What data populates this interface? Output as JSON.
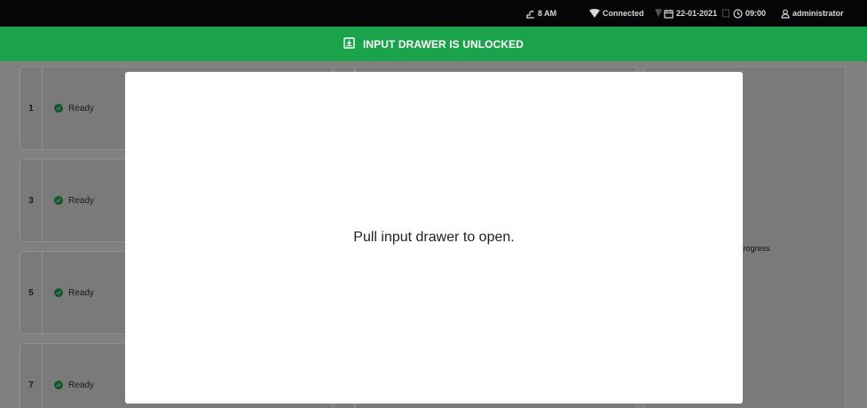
{
  "status_bar": {
    "time_label": "8 AM",
    "connection": "Connected",
    "date": "22-01-2021",
    "clock": "09:00",
    "user": "administrator"
  },
  "banner": {
    "text": "INPUT DRAWER IS UNLOCKED",
    "icon": "drawer-unlocked-icon",
    "color": "#1ba34c"
  },
  "slots": [
    {
      "number": "1",
      "status": "Ready"
    },
    {
      "number": "3",
      "status": "Ready"
    },
    {
      "number": "5",
      "status": "Ready"
    },
    {
      "number": "7",
      "status": "Ready"
    }
  ],
  "right_panel": {
    "partial_text": "n progress"
  },
  "modal": {
    "message": "Pull input drawer to open."
  },
  "colors": {
    "status_ready": "#0f5a2b",
    "topbar": "#050505",
    "overlay": "#808080"
  }
}
